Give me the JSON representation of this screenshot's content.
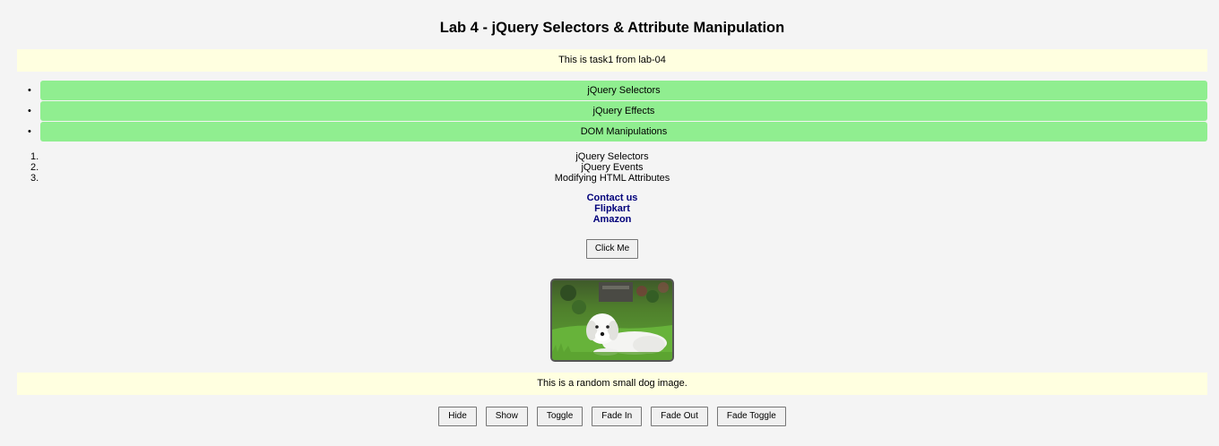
{
  "page": {
    "title": "Lab 4 - jQuery Selectors & Attribute Manipulation",
    "task_banner": "This is task1 from lab-04",
    "image_caption": "This is a random small dog image."
  },
  "unordered_list": {
    "bullet": "•",
    "items": [
      "jQuery Selectors",
      "jQuery Effects",
      "DOM Manipulations"
    ],
    "bg_color": "#90ee90"
  },
  "ordered_list": {
    "items": [
      {
        "num": "1.",
        "label": "jQuery Selectors"
      },
      {
        "num": "2.",
        "label": "jQuery Events"
      },
      {
        "num": "3.",
        "label": "Modifying HTML Attributes"
      }
    ]
  },
  "links": [
    "Contact us",
    "Flipkart",
    "Amazon"
  ],
  "click_button": "Click Me",
  "effect_buttons": [
    "Hide",
    "Show",
    "Toggle",
    "Fade In",
    "Fade Out",
    "Fade Toggle"
  ],
  "colors": {
    "banner_bg": "#ffffe0",
    "link_color": "#00007a",
    "page_bg": "#f4f4f4"
  }
}
